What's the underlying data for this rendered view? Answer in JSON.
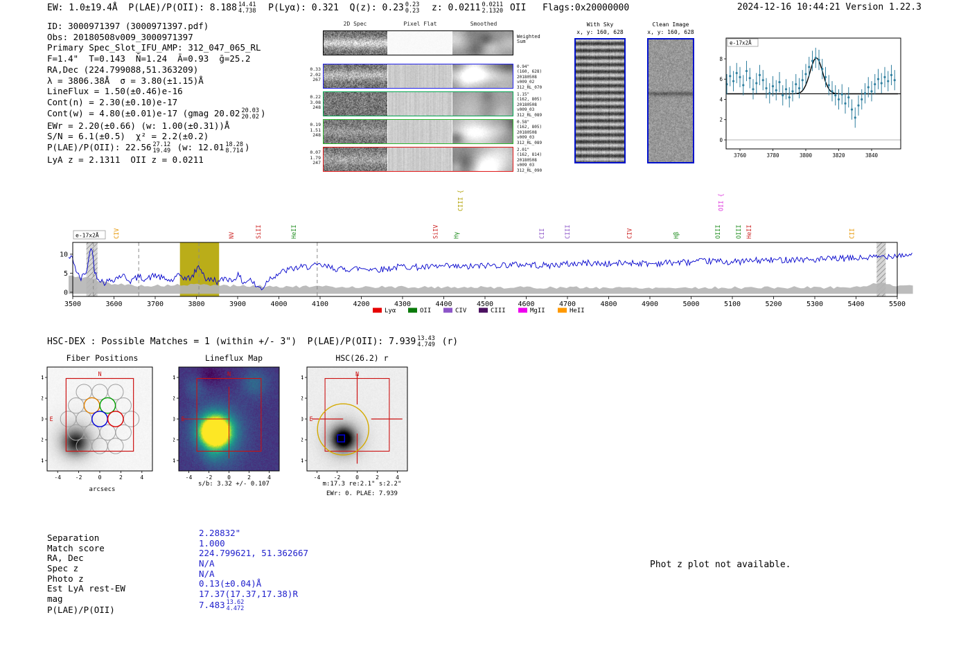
{
  "header": {
    "segments": [
      {
        "t": "EW: 1.0±19.4Å  P(LAE)/P(OII): 8.188"
      },
      {
        "f": [
          "14.41",
          "4.738"
        ]
      },
      {
        "t": "  P(Lyα): 0.321  Q(z): 0.23"
      },
      {
        "f": [
          "0.23",
          "0.23"
        ]
      },
      {
        "t": "  z: 0.0211"
      },
      {
        "f": [
          "0.0211",
          "2.1320"
        ]
      },
      {
        "t": " OII   Flags:0x20000000"
      }
    ],
    "timestamp": "2024-12-16 10:44:21  Version 1.22.3"
  },
  "info": {
    "lines": [
      [
        {
          "t": "ID: 3000971397 (3000971397.pdf)"
        }
      ],
      [
        {
          "t": "Obs: 20180508v009_3000971397"
        }
      ],
      [
        {
          "t": "Primary Spec_Slot_IFU_AMP: 312_047_065_RL"
        }
      ],
      [
        {
          "t": "F=1.4\"  T=0.143  N̄=1.24  Ā=0.93  ḡ=25.2"
        }
      ],
      [
        {
          "t": "RA,Dec (224.799088,51.363209)"
        }
      ],
      [
        {
          "t": "λ = 3806.38Å  σ = 3.80(±1.15)Å"
        }
      ],
      [
        {
          "t": "LineFlux = 1.50(±0.46)e-16"
        }
      ],
      [
        {
          "t": "Cont(n) = 2.30(±0.10)e-17"
        }
      ],
      [
        {
          "t": "Cont(w) = 4.80(±0.01)e-17 (gmag 20.02"
        },
        {
          "f": [
            "20.03",
            "20.02"
          ]
        },
        {
          "t": ")"
        }
      ],
      [
        {
          "t": "EWr = 2.20(±0.66) (w: 1.00(±0.31))Å"
        }
      ],
      [
        {
          "t": "S/N = 6.1(±0.5)  χ² = 2.2(±0.2)"
        }
      ],
      [
        {
          "t": "P(LAE)/P(OII): 22.56"
        },
        {
          "f": [
            "27.12",
            "19.49"
          ]
        },
        {
          "t": " (w: 12.01"
        },
        {
          "f": [
            "18.28",
            "8.714"
          ]
        },
        {
          "t": ")"
        }
      ],
      [
        {
          "t": "LyA z = 2.1311  OII z = 0.0211"
        }
      ]
    ]
  },
  "cutouts": {
    "col_headers": [
      "2D Spec",
      "Pixel Flat",
      "Smoothed"
    ],
    "rows": [
      {
        "border": "#000000",
        "left": [],
        "right": [
          "Weighted",
          "Sum"
        ]
      },
      {
        "border": "#2222ee",
        "left": [
          "0.33",
          "2.02",
          "267"
        ],
        "right": [
          "0.94\"",
          "(160, 628)",
          "20180508",
          "v009_02",
          "312_RL_070"
        ]
      },
      {
        "border": "#00a550",
        "left": [
          "0.22",
          "3.08",
          "248"
        ],
        "right": [
          "1.15\"",
          "(162, 805)",
          "20180508",
          "v009_03",
          "312_RL_089"
        ]
      },
      {
        "border": "#2db52d",
        "left": [
          "0.19",
          "1.51",
          "248"
        ],
        "right": [
          "0.58\"",
          "(162, 805)",
          "20180508",
          "v009_03",
          "312_RL_089"
        ]
      },
      {
        "border": "#e01818",
        "left": [
          "0.07",
          "1.79",
          "247"
        ],
        "right": [
          "2.01\"",
          "(162, 814)",
          "20180508",
          "v009_03",
          "312_RL_090"
        ]
      }
    ]
  },
  "sky": {
    "with_sky": {
      "title": "With Sky",
      "coords": "x, y: 160, 628"
    },
    "clean": {
      "title": "Clean Image",
      "coords": "x, y: 160, 628"
    }
  },
  "hsc_header": {
    "segments": [
      {
        "t": "HSC-DEX : Possible Matches = 1 (within +/- 3\")  P(LAE)/P(OII): 7.939"
      },
      {
        "f": [
          "13.43",
          "4.749"
        ]
      },
      {
        "t": " (r)"
      }
    ]
  },
  "match": {
    "value_color": "#2020cc",
    "rows": [
      {
        "label": "Separation",
        "segments": [
          {
            "t": "2.28832\""
          }
        ]
      },
      {
        "label": "Match score",
        "segments": [
          {
            "t": "1.000"
          }
        ]
      },
      {
        "label": "RA, Dec",
        "segments": [
          {
            "t": "224.799621, 51.362667"
          }
        ]
      },
      {
        "label": "Spec z",
        "segments": [
          {
            "t": "N/A"
          }
        ]
      },
      {
        "label": "Photo z",
        "segments": [
          {
            "t": "N/A"
          }
        ]
      },
      {
        "label": "Est LyA rest-EW",
        "segments": [
          {
            "t": "0.13(±0.04)Å"
          }
        ]
      },
      {
        "label": "mag",
        "segments": [
          {
            "t": "17.37(17.37,17.38)R"
          }
        ]
      },
      {
        "label": "P(LAE)/P(OII)",
        "segments": [
          {
            "t": "7.483"
          },
          {
            "f": [
              "13.62",
              "4.472"
            ]
          }
        ]
      }
    ]
  },
  "phot_z_note": "Phot z plot not available.",
  "chart_data": [
    {
      "id": "line_fit_inset",
      "type": "scatter",
      "annotation": "e-17x2Å",
      "xlim": [
        3751,
        3858
      ],
      "ylim": [
        -1,
        10
      ],
      "xticks": [
        3760,
        3780,
        3800,
        3820,
        3840
      ],
      "yticks": [
        0,
        2,
        4,
        6,
        8
      ],
      "point_color": "#2f7f9f",
      "fit_color": "#000000",
      "fit": {
        "type": "gaussian",
        "center": 3806.38,
        "sigma": 3.8,
        "amplitude": 3.55,
        "baseline": 4.55
      },
      "yerr": 1.0,
      "x": [
        3752,
        3754,
        3756,
        3758,
        3760,
        3762,
        3764,
        3766,
        3768,
        3770,
        3772,
        3774,
        3776,
        3778,
        3780,
        3782,
        3784,
        3786,
        3788,
        3790,
        3792,
        3794,
        3796,
        3798,
        3800,
        3802,
        3804,
        3806,
        3808,
        3810,
        3812,
        3814,
        3816,
        3818,
        3820,
        3822,
        3824,
        3826,
        3828,
        3830,
        3832,
        3834,
        3836,
        3838,
        3840,
        3842,
        3844,
        3846,
        3848,
        3850,
        3852,
        3854
      ],
      "y": [
        5.5,
        6.3,
        5.8,
        6.6,
        6.2,
        5.4,
        6.8,
        6.1,
        5.0,
        5.6,
        6.4,
        5.9,
        5.1,
        4.6,
        5.3,
        4.9,
        5.7,
        4.4,
        5.0,
        4.2,
        4.8,
        5.5,
        5.1,
        5.9,
        6.5,
        7.2,
        7.8,
        8.1,
        7.9,
        7.0,
        6.2,
        5.4,
        4.8,
        4.4,
        4.0,
        4.5,
        3.6,
        4.2,
        3.0,
        2.2,
        3.4,
        4.0,
        4.6,
        5.2,
        4.8,
        5.5,
        6.0,
        5.6,
        6.2,
        5.8,
        6.4,
        5.9
      ]
    },
    {
      "id": "full_spectrum",
      "type": "line",
      "annotation": "e-17x2Å",
      "xlim": [
        3470,
        5540
      ],
      "ylim": [
        -1.1,
        13.1
      ],
      "xticks": [
        3500,
        3600,
        3700,
        3800,
        3900,
        4000,
        4100,
        4200,
        4300,
        4400,
        4500,
        4600,
        4700,
        4800,
        4900,
        5000,
        5100,
        5200,
        5300,
        5400,
        5500
      ],
      "yticks": [
        0,
        5,
        10
      ],
      "line_color": "#0000cc",
      "noise_amp": 0.85,
      "x_coarse": [
        3500,
        3510,
        3520,
        3535,
        3545,
        3552,
        3560,
        3575,
        3600,
        3620,
        3640,
        3660,
        3680,
        3700,
        3720,
        3740,
        3760,
        3775,
        3790,
        3800,
        3806,
        3812,
        3825,
        3840,
        3855,
        3870,
        3885,
        3900,
        3915,
        3930,
        3945,
        3960,
        3975,
        4000,
        4025,
        4050,
        4075,
        4100,
        4150,
        4200,
        4250,
        4300,
        4350,
        4400,
        4450,
        4500,
        4550,
        4600,
        4650,
        4700,
        4750,
        4800,
        4850,
        4900,
        4950,
        5000,
        5050,
        5100,
        5150,
        5200,
        5250,
        5300,
        5350,
        5400,
        5450,
        5500
      ],
      "y_coarse": [
        9,
        5,
        3.5,
        6,
        13,
        6,
        4,
        2.5,
        3.5,
        4.5,
        3,
        4,
        3.5,
        4.5,
        3.5,
        3,
        4.5,
        3.5,
        4,
        6,
        6.8,
        6,
        3,
        3.5,
        2.5,
        4,
        3,
        4.5,
        2.5,
        3.5,
        1.5,
        1,
        3.5,
        5,
        6,
        6.5,
        6.8,
        7,
        6,
        6.3,
        6,
        6.8,
        6.5,
        6.8,
        6.6,
        7,
        7.2,
        7.3,
        7,
        7.4,
        7.7,
        7.4,
        7.8,
        7.5,
        7.8,
        7.9,
        8.2,
        7.9,
        8.3,
        8.4,
        8.7,
        8.5,
        8.8,
        8.9,
        9.2,
        9.8
      ],
      "error_band": {
        "x": [
          3500,
          3540,
          3560,
          3600,
          3650,
          3700,
          3800,
          3900,
          4000,
          4200,
          4500,
          4800,
          5100,
          5400,
          5440,
          5470,
          5500
        ],
        "top": [
          4.2,
          3.8,
          3,
          2.2,
          1.8,
          1.7,
          2.0,
          1.7,
          1.5,
          1.4,
          1.3,
          1.2,
          1.2,
          1.3,
          2.2,
          2.2,
          1.8
        ],
        "color": "#b5b5b5"
      },
      "highlight_band": {
        "x0": 3760,
        "x1": 3855,
        "color": "#b3a400",
        "opacity": 0.9
      },
      "hatch_bands": [
        {
          "x0": 3533,
          "x1": 3560
        },
        {
          "x0": 5450,
          "x1": 5472
        }
      ],
      "dashed_lines": [
        3550,
        3660,
        3806,
        4093
      ],
      "line_markers": [
        {
          "wave": 3606,
          "label": "CIV",
          "color": "#e69500",
          "high": false
        },
        {
          "wave": 3885,
          "label": "NV",
          "color": "#cc2222",
          "high": false
        },
        {
          "wave": 3950,
          "label": "SiII",
          "color": "#cc2222",
          "high": false
        },
        {
          "wave": 4036,
          "label": "HeII",
          "color": "#1e8c1e",
          "high": false
        },
        {
          "wave": 4380,
          "label": "SiIV",
          "color": "#cc2222",
          "high": false
        },
        {
          "wave": 4430,
          "label": "Hγ",
          "color": "#1e8c1e",
          "high": false
        },
        {
          "wave": 4440,
          "label": "CIII {",
          "color": "#b0a000",
          "high": true
        },
        {
          "wave": 4638,
          "label": "CII",
          "color": "#8c55c8",
          "high": false
        },
        {
          "wave": 4700,
          "label": "CIII",
          "color": "#8c55c8",
          "high": false
        },
        {
          "wave": 4850,
          "label": "CIV",
          "color": "#cc2222",
          "high": false
        },
        {
          "wave": 4964,
          "label": "Hβ",
          "color": "#1e8c1e",
          "high": false
        },
        {
          "wave": 5065,
          "label": "OIII",
          "color": "#1e8c1e",
          "high": false
        },
        {
          "wave": 5072,
          "label": "OII {",
          "color": "#dd33dd",
          "high": true
        },
        {
          "wave": 5115,
          "label": "OIII",
          "color": "#1e8c1e",
          "high": false
        },
        {
          "wave": 5140,
          "label": "HeII",
          "color": "#cc2222",
          "high": false
        },
        {
          "wave": 5390,
          "label": "CII",
          "color": "#e69500",
          "high": false
        }
      ],
      "legend": [
        {
          "label": "Lyα",
          "color": "#e60000"
        },
        {
          "label": "OII",
          "color": "#0a7a0a"
        },
        {
          "label": "CIV",
          "color": "#8c55c8"
        },
        {
          "label": "CIII",
          "color": "#4b1060"
        },
        {
          "label": "MgII",
          "color": "#ee00ee"
        },
        {
          "label": "HeII",
          "color": "#ff9900"
        }
      ]
    },
    {
      "id": "fiber_positions_map",
      "type": "scatter",
      "title": "Fiber Positions",
      "xlabel": "arcsecs",
      "north": "N",
      "east": "E",
      "xticks": [
        -4,
        -2,
        0,
        2,
        4
      ],
      "yticks": [
        -4,
        -2,
        0,
        2,
        4
      ],
      "fiber_rows": [
        {
          "y": 2.598,
          "x": [
            -1.5,
            0,
            1.5
          ]
        },
        {
          "y": 1.299,
          "x": [
            -2.25,
            -0.75,
            0.75,
            2.25
          ]
        },
        {
          "y": 0,
          "x": [
            -3,
            -1.5,
            0,
            1.5,
            3
          ]
        },
        {
          "y": -1.299,
          "x": [
            -2.25,
            -0.75,
            0.75,
            2.25
          ]
        },
        {
          "y": -2.598,
          "x": [
            -1.5,
            0,
            1.5
          ]
        }
      ],
      "highlight_fibers": [
        {
          "x": -0.75,
          "y": 1.299,
          "color": "#e08000"
        },
        {
          "x": 0.75,
          "y": 1.299,
          "color": "#00a000"
        },
        {
          "x": 0,
          "y": 0,
          "color": "#0000dd"
        },
        {
          "x": 1.5,
          "y": 0,
          "color": "#dd0000"
        }
      ],
      "ifu_box": [
        -3.2,
        -3.1,
        3.2,
        3.9
      ]
    },
    {
      "id": "lineflux_map",
      "type": "heatmap",
      "title": "Lineflux Map",
      "caption": "s/b: 3.32 +/- 0.107",
      "north": "N",
      "east": "E",
      "xticks": [
        -4,
        -2,
        0,
        2,
        4
      ],
      "yticks": [
        -4,
        -2,
        0,
        2,
        4
      ],
      "palette": "viridis",
      "bright_blob_arcsec": [
        -1.6,
        -1.5
      ]
    },
    {
      "id": "hsc_cutout",
      "type": "heatmap",
      "title": "HSC(26.2) r",
      "captions": [
        "m:17.3 re:2.1\" s:2.2\"",
        "EWr: 0. PLAE: 7.939"
      ],
      "north": "N",
      "east": "E",
      "xticks": [
        -4,
        -2,
        0,
        2,
        4
      ],
      "yticks": [
        -4,
        -2,
        0,
        2,
        4
      ],
      "aperture_circle": {
        "center": [
          -1.4,
          -1.0
        ],
        "radius": 2.55,
        "color": "#d4aa00"
      },
      "source_marker": {
        "center": [
          -1.6,
          -1.87
        ],
        "color": "#0000dd"
      }
    }
  ]
}
